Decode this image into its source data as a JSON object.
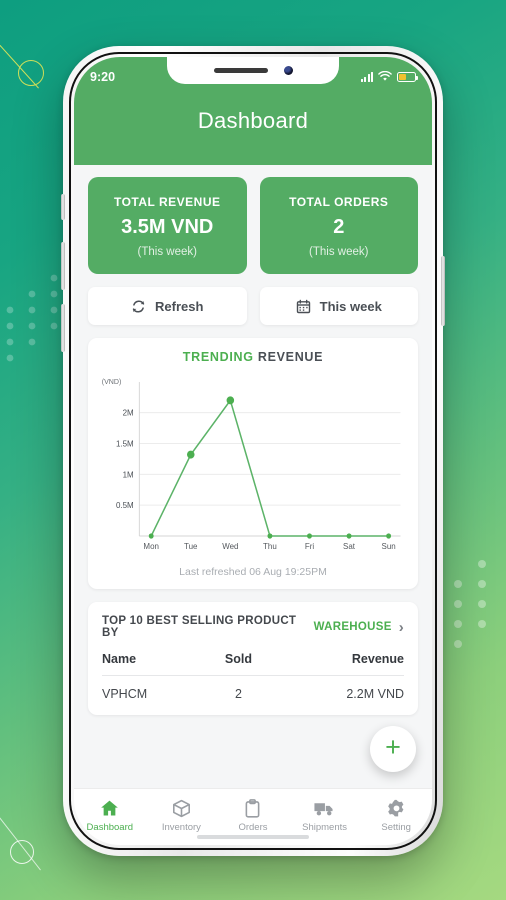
{
  "status_bar": {
    "time": "9:20",
    "signal_icon": "signal-bars-icon",
    "wifi_icon": "wifi-icon",
    "battery_icon": "battery-icon",
    "battery_color": "#f2c230"
  },
  "header": {
    "title": "Dashboard",
    "background_color": "#54ac64"
  },
  "stats": [
    {
      "label": "TOTAL REVENUE",
      "value": "3.5M VND",
      "sub": "(This week)"
    },
    {
      "label": "TOTAL ORDERS",
      "value": "2",
      "sub": "(This week)"
    }
  ],
  "actions": [
    {
      "label": "Refresh",
      "icon": "refresh-icon"
    },
    {
      "label": "This week",
      "icon": "calendar-icon"
    }
  ],
  "chart_card": {
    "title_highlight": "TRENDING",
    "title_rest": "REVENUE",
    "last_refreshed": "Last refreshed 06 Aug 19:25PM"
  },
  "chart_data": {
    "type": "line",
    "title": "TRENDING REVENUE",
    "xlabel": "",
    "ylabel": "(VND)",
    "categories": [
      "Mon",
      "Tue",
      "Wed",
      "Thu",
      "Fri",
      "Sat",
      "Sun"
    ],
    "values": [
      0,
      1320000,
      2200000,
      0,
      0,
      0,
      0
    ],
    "ytick_labels": [
      "0.5M",
      "1M",
      "1.5M",
      "2M"
    ],
    "ytick_values": [
      500000,
      1000000,
      1500000,
      2000000
    ],
    "ylim": [
      0,
      2400000
    ],
    "grid": true,
    "legend": "none",
    "line_color": "#5cb368",
    "marker_color": "#4caf50"
  },
  "products_card": {
    "heading_prefix": "TOP 10 BEST SELLING PRODUCT BY",
    "heading_highlight": "WAREHOUSE",
    "chevron_icon": "chevron-right-icon",
    "columns": [
      "Name",
      "Sold",
      "Revenue"
    ],
    "rows": [
      {
        "name": "VPHCM",
        "sold": "2",
        "revenue": "2.2M VND"
      }
    ]
  },
  "fab": {
    "icon": "plus-icon",
    "color": "#4caf50"
  },
  "bottom_nav": {
    "active_color": "#4caf50",
    "items": [
      {
        "label": "Dashboard",
        "icon": "home-icon",
        "active": true
      },
      {
        "label": "Inventory",
        "icon": "box-icon",
        "active": false
      },
      {
        "label": "Orders",
        "icon": "clipboard-icon",
        "active": false
      },
      {
        "label": "Shipments",
        "icon": "truck-icon",
        "active": false
      },
      {
        "label": "Setting",
        "icon": "gear-icon",
        "active": false
      }
    ]
  }
}
